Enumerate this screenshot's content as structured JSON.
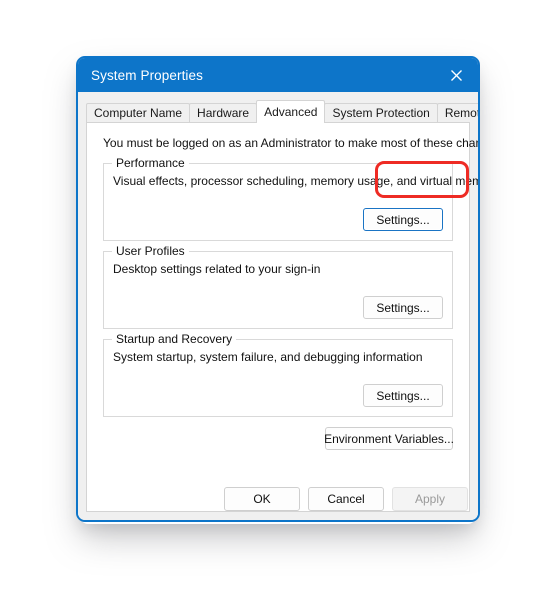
{
  "window": {
    "title": "System Properties",
    "close_icon": "close-icon",
    "accent_color": "#0d75c9",
    "highlight_color": "#ee2b24"
  },
  "tabs": [
    {
      "label": "Computer Name",
      "selected": false
    },
    {
      "label": "Hardware",
      "selected": false
    },
    {
      "label": "Advanced",
      "selected": true
    },
    {
      "label": "System Protection",
      "selected": false
    },
    {
      "label": "Remote",
      "selected": false
    }
  ],
  "content": {
    "admin_note": "You must be logged on as an Administrator to make most of these changes.",
    "groups": [
      {
        "legend": "Performance",
        "description": "Visual effects, processor scheduling, memory usage, and virtual memory",
        "button_label": "Settings...",
        "highlighted": true
      },
      {
        "legend": "User Profiles",
        "description": "Desktop settings related to your sign-in",
        "button_label": "Settings...",
        "highlighted": false
      },
      {
        "legend": "Startup and Recovery",
        "description": "System startup, system failure, and debugging information",
        "button_label": "Settings...",
        "highlighted": false
      }
    ],
    "environment_variables_label": "Environment Variables..."
  },
  "footer": {
    "ok_label": "OK",
    "cancel_label": "Cancel",
    "apply_label": "Apply",
    "apply_disabled": true
  }
}
